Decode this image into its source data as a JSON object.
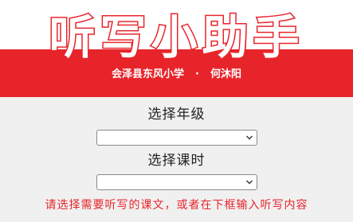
{
  "header": {
    "title": "听写小助手",
    "school": "会泽县东风小学",
    "separator": "·",
    "author": "何沐阳"
  },
  "form": {
    "grade_label": "选择年级",
    "grade_value": "",
    "lesson_label": "选择课时",
    "lesson_value": ""
  },
  "hint": "请选择需要听写的课文，或者在下框输入听写内容",
  "colors": {
    "brand_red": "#e8242b",
    "background": "#f0f0f0"
  }
}
